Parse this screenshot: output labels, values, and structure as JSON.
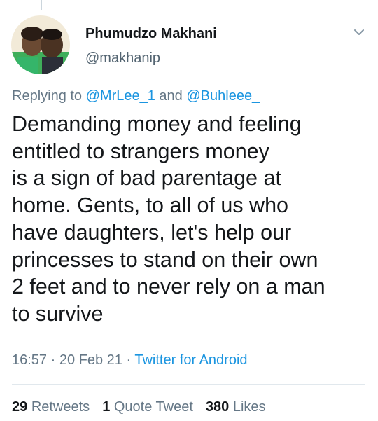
{
  "tweet": {
    "author_name": "Phumudzo Makhani",
    "author_handle": "@makhanip",
    "replying_prefix": "Replying to ",
    "reply_mention_1": "@MrLee_1",
    "reply_and": " and ",
    "reply_mention_2": "@Buhleee_",
    "text": "Demanding money and feeling\nentitled to strangers money\nis a sign of bad parentage at\nhome. Gents, to all of us who\nhave daughters, let's help our\nprincesses to stand on their own\n2 feet and to never rely on a man\nto survive",
    "time": "16:57",
    "separator": " · ",
    "date": "20 Feb 21",
    "source": "Twitter for Android"
  },
  "stats": {
    "retweets_count": "29",
    "retweets_label": "Retweets",
    "quotes_count": "1",
    "quotes_label": "Quote Tweet",
    "likes_count": "380",
    "likes_label": "Likes"
  },
  "icons": {
    "menu": "chevron-down-icon",
    "avatar": "profile-photo"
  },
  "colors": {
    "link": "#1b95e0",
    "secondary_text": "#657786",
    "primary_text": "#14171a",
    "divider": "#e1e8ed"
  }
}
